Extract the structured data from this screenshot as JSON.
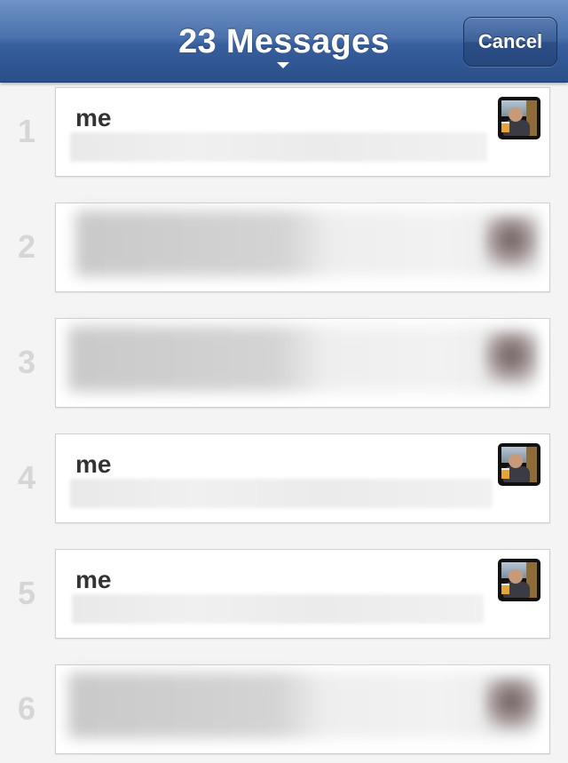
{
  "navbar": {
    "title": "23 Messages",
    "cancel_label": "Cancel"
  },
  "messages": [
    {
      "index": "1",
      "sender": "me",
      "avatar": "profile-photo",
      "preview_blurred": true
    },
    {
      "index": "2",
      "sender": "",
      "avatar": "blurred",
      "content_blurred": true
    },
    {
      "index": "3",
      "sender": "",
      "avatar": "blurred",
      "content_blurred": true
    },
    {
      "index": "4",
      "sender": "me",
      "avatar": "profile-photo",
      "preview_blurred": true
    },
    {
      "index": "5",
      "sender": "me",
      "avatar": "profile-photo",
      "preview_blurred": true
    },
    {
      "index": "6",
      "sender": "",
      "avatar": "blurred",
      "content_blurred": true
    }
  ],
  "colors": {
    "navbar_blue": "#3a62a0",
    "row_number_gray": "#d6d6d6",
    "sender_text": "#333333",
    "background": "#f4f4f4"
  }
}
